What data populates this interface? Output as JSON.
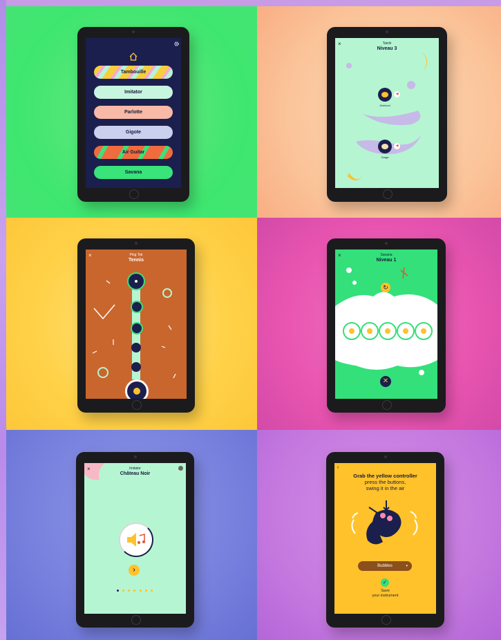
{
  "colors": {
    "navy": "#1b1f4d",
    "mint": "#b5f5d2",
    "green": "#33e07a",
    "yellow": "#ffc22a",
    "terracotta": "#c9662d",
    "lavender": "#c7b9e8"
  },
  "menu_screen": {
    "top_icon": "home-icon",
    "settings_icon": "gear-icon",
    "items": [
      "Tambouille",
      "Imitator",
      "Parlotte",
      "Gigote",
      "Air Guitar",
      "Savana"
    ]
  },
  "taichi_screen": {
    "subtitle": "Taichi",
    "title": "Niveau 3",
    "close_label": "×",
    "items": [
      {
        "label": "Zenlounl",
        "icon": "sound-icon"
      },
      {
        "label": "Orage",
        "icon": "sound-icon"
      }
    ]
  },
  "tennis_screen": {
    "subtitle": "Ping Tok",
    "title": "Tennis",
    "close_label": "×"
  },
  "savana_screen": {
    "subtitle": "Savana",
    "title": "Niveau 1",
    "close_label": "×",
    "refresh_icon": "refresh-icon",
    "dismiss_icon": "close-icon"
  },
  "imitator_screen": {
    "subtitle": "Imitator",
    "title": "Château Noir",
    "close_label": "×",
    "play_icon": "speaker-music-icon",
    "next_icon": "chevron-right-icon",
    "page_dots": 7,
    "active_dot": 1
  },
  "instrument_screen": {
    "instruction_line1": "Grab the yellow controller",
    "instruction_line2": "press the buttons,",
    "instruction_line3": "swing it in the air",
    "dropdown_value": "Bubbles",
    "save_line1": "Save",
    "save_line2": "your instrument",
    "check_icon": "check-icon"
  }
}
